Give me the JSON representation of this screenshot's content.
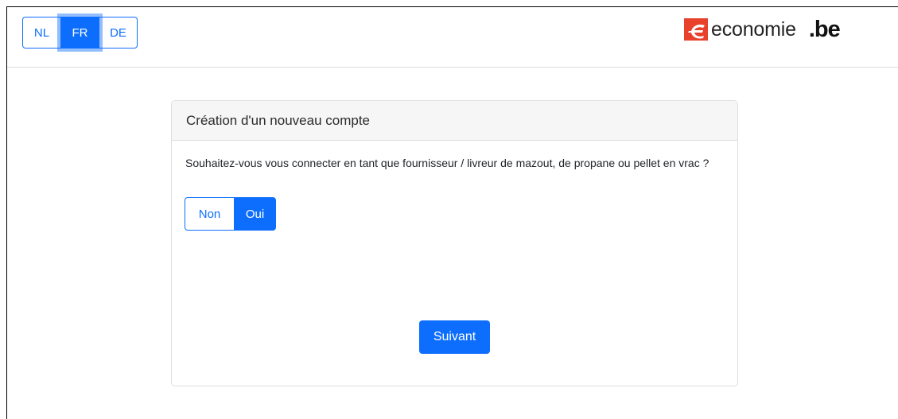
{
  "header": {
    "languages": [
      {
        "code": "NL",
        "active": false
      },
      {
        "code": "FR",
        "active": true
      },
      {
        "code": "DE",
        "active": false
      }
    ],
    "logo": {
      "name": "economie",
      "domain": ".be",
      "icon": "economie-logo-icon",
      "color": "#e8412c"
    }
  },
  "card": {
    "title": "Création d'un nouveau compte",
    "question": "Souhaitez-vous vous connecter en tant que fournisseur / livreur de mazout, de propane ou pellet en vrac ?",
    "options": {
      "no_label": "Non",
      "yes_label": "Oui",
      "selected": "Oui"
    },
    "submit_label": "Suivant"
  },
  "colors": {
    "primary": "#0d6efd",
    "card_header_bg": "#f6f6f6",
    "brand_red": "#e8412c"
  }
}
